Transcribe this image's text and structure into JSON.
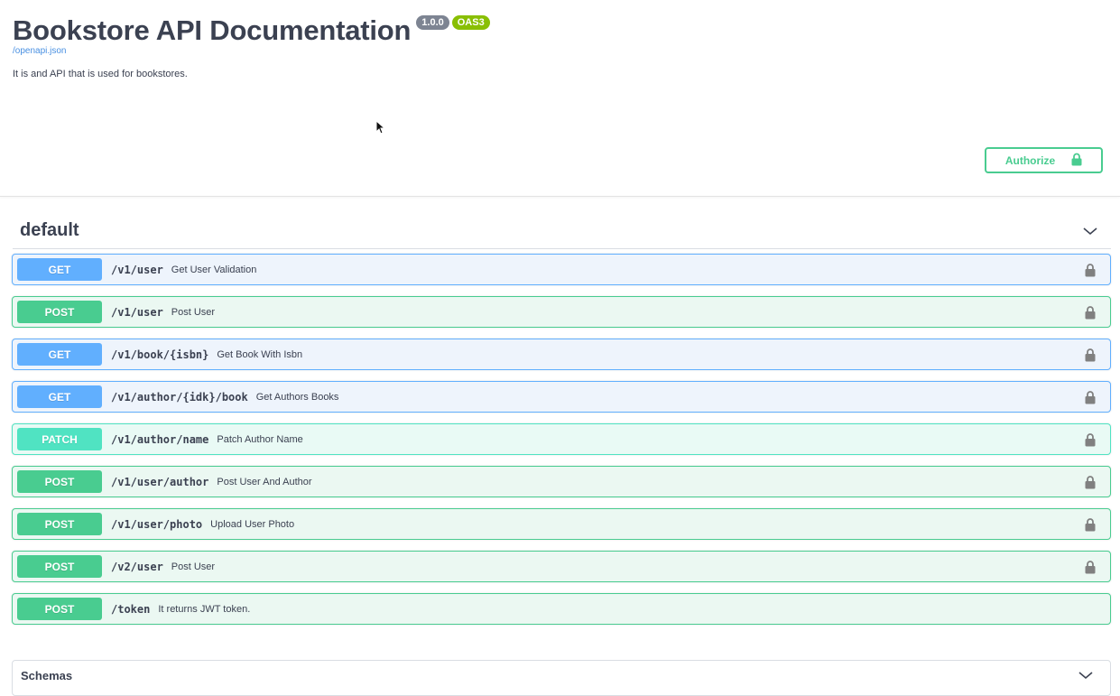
{
  "info": {
    "title": "Bookstore API Documentation",
    "version_badge": "1.0.0",
    "oas_badge": "OAS3",
    "spec_link": "/openapi.json",
    "description": "It is and API that is used for bookstores."
  },
  "authorize": {
    "label": "Authorize",
    "icon": "lock-icon",
    "color": "#49cc90"
  },
  "tag": {
    "name": "default",
    "toggle_icon": "chevron-down-icon"
  },
  "method_colors": {
    "GET": "#61affe",
    "POST": "#49cc90",
    "PATCH": "#50e3c2"
  },
  "operations": [
    {
      "method": "GET",
      "path": "/v1/user",
      "summary": "Get User Validation",
      "locked": true
    },
    {
      "method": "POST",
      "path": "/v1/user",
      "summary": "Post User",
      "locked": true
    },
    {
      "method": "GET",
      "path": "/v1/book/{isbn}",
      "summary": "Get Book With Isbn",
      "locked": true
    },
    {
      "method": "GET",
      "path": "/v1/author/{idk}/book",
      "summary": "Get Authors Books",
      "locked": true
    },
    {
      "method": "PATCH",
      "path": "/v1/author/name",
      "summary": "Patch Author Name",
      "locked": true
    },
    {
      "method": "POST",
      "path": "/v1/user/author",
      "summary": "Post User And Author",
      "locked": true
    },
    {
      "method": "POST",
      "path": "/v1/user/photo",
      "summary": "Upload User Photo",
      "locked": true
    },
    {
      "method": "POST",
      "path": "/v2/user",
      "summary": "Post User",
      "locked": true
    },
    {
      "method": "POST",
      "path": "/token",
      "summary": "It returns JWT token.",
      "locked": false
    }
  ],
  "schemas": {
    "title": "Schemas",
    "toggle_icon": "chevron-down-icon"
  }
}
